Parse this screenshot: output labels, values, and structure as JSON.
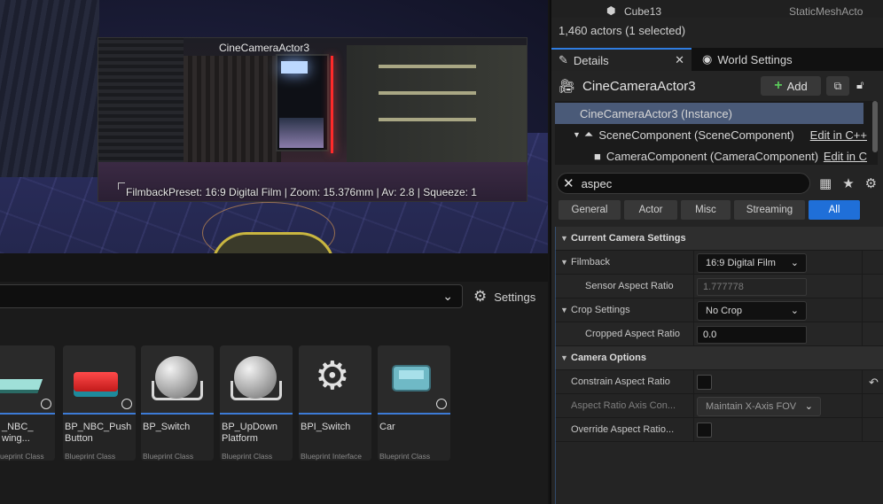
{
  "viewport": {
    "camera_title": "CineCameraActor3",
    "filmback_info": "FilmbackPreset: 16:9 Digital Film | Zoom: 15.376mm | Av: 2.8 | Squeeze: 1"
  },
  "content_browser": {
    "settings_label": "Settings",
    "assets": [
      {
        "name": "_NBC_\nwing...",
        "class": "ueprint Class"
      },
      {
        "name": "BP_NBC_Push\nButton",
        "class": "Blueprint Class"
      },
      {
        "name": "BP_Switch",
        "class": "Blueprint Class"
      },
      {
        "name": "BP_UpDown\nPlatform",
        "class": "Blueprint Class"
      },
      {
        "name": "BPI_Switch",
        "class": "Blueprint Interface"
      },
      {
        "name": "Car",
        "class": "Blueprint Class"
      }
    ]
  },
  "outliner": {
    "row_name": "Cube13",
    "row_class": "StaticMeshActo",
    "actor_count": "1,460 actors (1 selected)"
  },
  "tabs": {
    "details": "Details",
    "world_settings": "World Settings"
  },
  "details": {
    "actor_name": "CineCameraActor3",
    "add_label": "Add",
    "components": [
      {
        "label": "CineCameraActor3 (Instance)",
        "edit": ""
      },
      {
        "label": "SceneComponent (SceneComponent)",
        "edit": "Edit in C++"
      },
      {
        "label": "CameraComponent (CameraComponent)",
        "edit": "Edit in C"
      }
    ],
    "search_value": "aspec",
    "filters": [
      "General",
      "Actor",
      "Misc",
      "Streaming",
      "All"
    ],
    "categories": {
      "current_camera": "Current Camera Settings",
      "camera_options": "Camera Options"
    },
    "props": {
      "filmback_label": "Filmback",
      "filmback_value": "16:9 Digital Film",
      "sensor_aspect_label": "Sensor Aspect Ratio",
      "sensor_aspect_value": "1.777778",
      "crop_settings_label": "Crop Settings",
      "crop_settings_value": "No Crop",
      "cropped_aspect_label": "Cropped Aspect Ratio",
      "cropped_aspect_value": "0.0",
      "constrain_label": "Constrain Aspect Ratio",
      "axis_constraint_label": "Aspect Ratio Axis Con...",
      "axis_constraint_value": "Maintain X-Axis FOV",
      "override_label": "Override Aspect Ratio..."
    }
  }
}
